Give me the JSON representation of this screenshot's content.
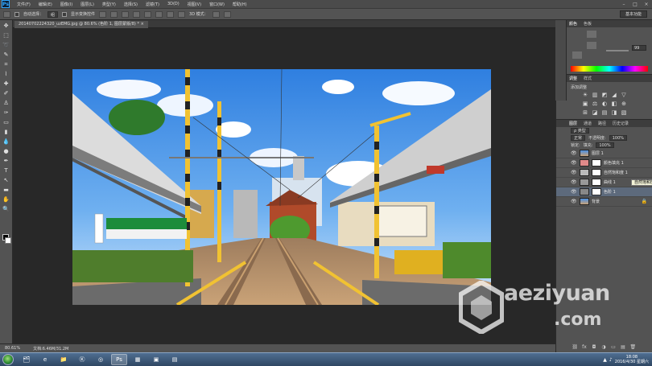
{
  "app": {
    "logo": "Ps",
    "menus": [
      "文件(F)",
      "编辑(E)",
      "图像(I)",
      "图层(L)",
      "类型(Y)",
      "选择(S)",
      "滤镜(T)",
      "3D(D)",
      "视图(V)",
      "窗口(W)",
      "帮助(H)"
    ]
  },
  "options": {
    "auto_select_label": "自动选择：",
    "auto_select_value": "组",
    "show_transform_label": "显示变换控件",
    "mode_3d_label": "3D 模式：",
    "workspace": "基本功能"
  },
  "document": {
    "tab_title": "20140702224320_uzEMG.jpg @ 80.6% (色阶 1, 图层蒙版/8) *",
    "close": "×"
  },
  "status": {
    "zoom": "80.61%",
    "doc_size": "文档:6.46M/31.2M"
  },
  "panels": {
    "color_tabs": [
      "颜色",
      "色板"
    ],
    "slider_value": "99",
    "adjust_tabs": [
      "调整",
      "样式"
    ],
    "adjust_title": "添加调整",
    "adj_icons": [
      "☀",
      "▥",
      "◩",
      "◢",
      "▽",
      "▣",
      "⚖",
      "◐",
      "◧",
      "⊕",
      "⊞",
      "◪",
      "▤",
      "◨",
      "▧"
    ],
    "layer_tabs": [
      "图层",
      "通道",
      "路径",
      "历史记录"
    ],
    "layer_filter": "ρ 类型",
    "blend_mode": "正常",
    "opacity_label": "不透明度:",
    "opacity_value": "100%",
    "lock_label": "锁定:",
    "fill_label": "填充:",
    "fill_value": "100%",
    "layers": [
      {
        "name": "图层 1",
        "eye": "👁"
      },
      {
        "name": "颜色填充 1",
        "eye": "👁"
      },
      {
        "name": "自然饱和度 1",
        "eye": "👁"
      },
      {
        "name": "曲线 1",
        "eye": "👁"
      },
      {
        "name": "色阶 1",
        "eye": "👁"
      },
      {
        "name": "背景",
        "eye": "👁"
      }
    ],
    "tooltip": "自然饱和度 1",
    "footer_icons": [
      "⛓",
      "fx",
      "◘",
      "◑",
      "▭",
      "▤",
      "🗑"
    ]
  },
  "taskbar": {
    "time": "18:08",
    "date": "2016/4/30 星期六"
  },
  "watermark": {
    "line1": "aeziyuan",
    "line2": ".com"
  },
  "colors": {
    "accent": "#31a8ff",
    "panel_bg": "#535353",
    "canvas_bg": "#282828"
  }
}
